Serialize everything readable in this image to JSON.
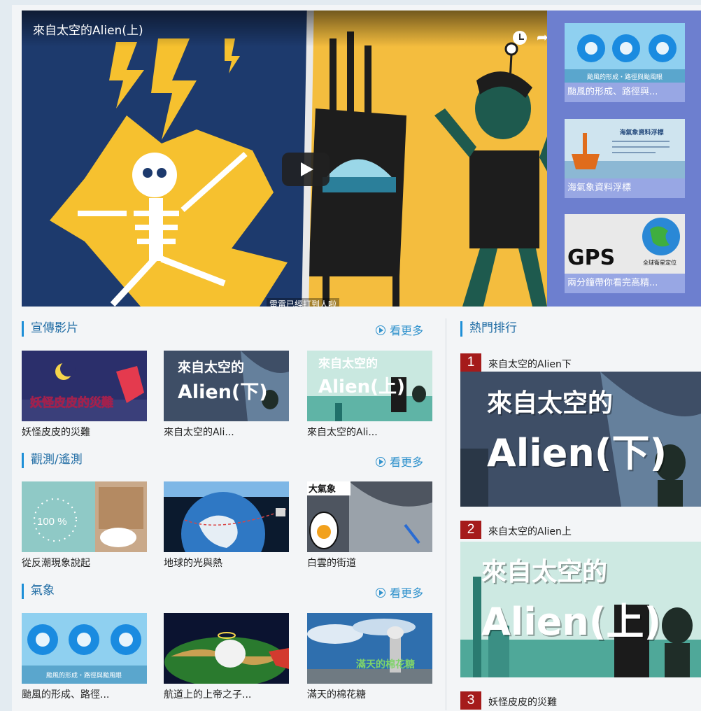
{
  "featured": {
    "title": "來自太空的Alien(上)",
    "caption": "雷電已經打到人啦"
  },
  "playlist": [
    {
      "label": "颱風的形成、路徑與...",
      "thumb_text": "颱風的形成・路徑與颱風眼"
    },
    {
      "label": "海氣象資料浮標",
      "thumb_text": "海氣象資料浮標"
    },
    {
      "label": "兩分鐘帶你看完高精...",
      "thumb_text": "GPS",
      "thumb_sub": "全球衛星定位"
    }
  ],
  "sections": [
    {
      "title": "宣傳影片",
      "more": "看更多",
      "items": [
        {
          "label": "妖怪皮皮的災難",
          "thumb_text": "妖怪皮皮的災難"
        },
        {
          "label": "來自太空的Ali...",
          "thumb_text": "來自太空的",
          "thumb_sub": "Alien(下)"
        },
        {
          "label": "來自太空的Ali...",
          "thumb_text": "來自太空的",
          "thumb_sub": "Alien(上)"
        }
      ]
    },
    {
      "title": "觀測/遙測",
      "more": "看更多",
      "items": [
        {
          "label": "從反潮現象說起",
          "thumb_text": "100 %"
        },
        {
          "label": "地球的光與熱",
          "thumb_text": ""
        },
        {
          "label": "白雲的街道",
          "thumb_text": "大氣象"
        }
      ]
    },
    {
      "title": "氣象",
      "more": "看更多",
      "items": [
        {
          "label": "颱風的形成、路徑...",
          "thumb_text": "颱風的形成・路徑與颱風眼"
        },
        {
          "label": "航道上的上帝之子...",
          "thumb_text": ""
        },
        {
          "label": "滿天的棉花糖",
          "thumb_text": "滿天的棉花糖"
        }
      ]
    }
  ],
  "ranking": {
    "title": "熱門排行",
    "items": [
      {
        "rank": "1",
        "title": "來自太空的Alien下",
        "thumb_text": "來自太空的",
        "thumb_sub": "Alien(下)"
      },
      {
        "rank": "2",
        "title": "來自太空的Alien上",
        "thumb_text": "來自太空的",
        "thumb_sub": "Alien(上)"
      },
      {
        "rank": "3",
        "title": "妖怪皮皮的災難"
      }
    ]
  },
  "colors": {
    "accent": "#1d8fd7",
    "rank_badge": "#a51b1b",
    "sidebar": "#6d7fcf"
  }
}
